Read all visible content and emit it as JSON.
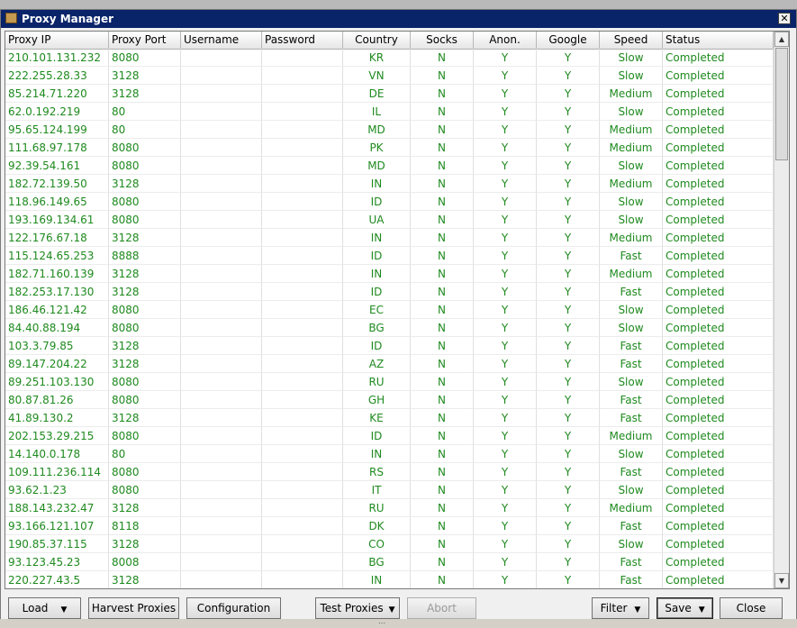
{
  "window": {
    "title": "Proxy Manager",
    "close_glyph": "✕",
    "icon": "box-icon"
  },
  "table": {
    "headers": [
      "Proxy IP",
      "Proxy Port",
      "Username",
      "Password",
      "Country",
      "Socks",
      "Anon.",
      "Google",
      "Speed",
      "Status"
    ],
    "rows": [
      [
        "210.101.131.232",
        "8080",
        "",
        "",
        "KR",
        "N",
        "Y",
        "Y",
        "Slow",
        "Completed"
      ],
      [
        "222.255.28.33",
        "3128",
        "",
        "",
        "VN",
        "N",
        "Y",
        "Y",
        "Slow",
        "Completed"
      ],
      [
        "85.214.71.220",
        "3128",
        "",
        "",
        "DE",
        "N",
        "Y",
        "Y",
        "Medium",
        "Completed"
      ],
      [
        "62.0.192.219",
        "80",
        "",
        "",
        "IL",
        "N",
        "Y",
        "Y",
        "Slow",
        "Completed"
      ],
      [
        "95.65.124.199",
        "80",
        "",
        "",
        "MD",
        "N",
        "Y",
        "Y",
        "Medium",
        "Completed"
      ],
      [
        "111.68.97.178",
        "8080",
        "",
        "",
        "PK",
        "N",
        "Y",
        "Y",
        "Medium",
        "Completed"
      ],
      [
        "92.39.54.161",
        "8080",
        "",
        "",
        "MD",
        "N",
        "Y",
        "Y",
        "Slow",
        "Completed"
      ],
      [
        "182.72.139.50",
        "3128",
        "",
        "",
        "IN",
        "N",
        "Y",
        "Y",
        "Medium",
        "Completed"
      ],
      [
        "118.96.149.65",
        "8080",
        "",
        "",
        "ID",
        "N",
        "Y",
        "Y",
        "Slow",
        "Completed"
      ],
      [
        "193.169.134.61",
        "8080",
        "",
        "",
        "UA",
        "N",
        "Y",
        "Y",
        "Slow",
        "Completed"
      ],
      [
        "122.176.67.18",
        "3128",
        "",
        "",
        "IN",
        "N",
        "Y",
        "Y",
        "Medium",
        "Completed"
      ],
      [
        "115.124.65.253",
        "8888",
        "",
        "",
        "ID",
        "N",
        "Y",
        "Y",
        "Fast",
        "Completed"
      ],
      [
        "182.71.160.139",
        "3128",
        "",
        "",
        "IN",
        "N",
        "Y",
        "Y",
        "Medium",
        "Completed"
      ],
      [
        "182.253.17.130",
        "3128",
        "",
        "",
        "ID",
        "N",
        "Y",
        "Y",
        "Fast",
        "Completed"
      ],
      [
        "186.46.121.42",
        "8080",
        "",
        "",
        "EC",
        "N",
        "Y",
        "Y",
        "Slow",
        "Completed"
      ],
      [
        "84.40.88.194",
        "8080",
        "",
        "",
        "BG",
        "N",
        "Y",
        "Y",
        "Slow",
        "Completed"
      ],
      [
        "103.3.79.85",
        "3128",
        "",
        "",
        "ID",
        "N",
        "Y",
        "Y",
        "Fast",
        "Completed"
      ],
      [
        "89.147.204.22",
        "3128",
        "",
        "",
        "AZ",
        "N",
        "Y",
        "Y",
        "Fast",
        "Completed"
      ],
      [
        "89.251.103.130",
        "8080",
        "",
        "",
        "RU",
        "N",
        "Y",
        "Y",
        "Slow",
        "Completed"
      ],
      [
        "80.87.81.26",
        "8080",
        "",
        "",
        "GH",
        "N",
        "Y",
        "Y",
        "Fast",
        "Completed"
      ],
      [
        "41.89.130.2",
        "3128",
        "",
        "",
        "KE",
        "N",
        "Y",
        "Y",
        "Fast",
        "Completed"
      ],
      [
        "202.153.29.215",
        "8080",
        "",
        "",
        "ID",
        "N",
        "Y",
        "Y",
        "Medium",
        "Completed"
      ],
      [
        "14.140.0.178",
        "80",
        "",
        "",
        "IN",
        "N",
        "Y",
        "Y",
        "Slow",
        "Completed"
      ],
      [
        "109.111.236.114",
        "8080",
        "",
        "",
        "RS",
        "N",
        "Y",
        "Y",
        "Fast",
        "Completed"
      ],
      [
        "93.62.1.23",
        "8080",
        "",
        "",
        "IT",
        "N",
        "Y",
        "Y",
        "Slow",
        "Completed"
      ],
      [
        "188.143.232.47",
        "3128",
        "",
        "",
        "RU",
        "N",
        "Y",
        "Y",
        "Medium",
        "Completed"
      ],
      [
        "93.166.121.107",
        "8118",
        "",
        "",
        "DK",
        "N",
        "Y",
        "Y",
        "Fast",
        "Completed"
      ],
      [
        "190.85.37.115",
        "3128",
        "",
        "",
        "CO",
        "N",
        "Y",
        "Y",
        "Slow",
        "Completed"
      ],
      [
        "93.123.45.23",
        "8008",
        "",
        "",
        "BG",
        "N",
        "Y",
        "Y",
        "Fast",
        "Completed"
      ],
      [
        "220.227.43.5",
        "3128",
        "",
        "",
        "IN",
        "N",
        "Y",
        "Y",
        "Fast",
        "Completed"
      ]
    ],
    "status_color": "#1e8a1e"
  },
  "toolbar": {
    "load_label": "Load",
    "harvest_label": "Harvest Proxies",
    "configuration_label": "Configuration",
    "test_label": "Test Proxies",
    "abort_label": "Abort",
    "filter_label": "Filter",
    "save_label": "Save",
    "close_label": "Close",
    "dropdown_glyph": "▼"
  },
  "scrollbar": {
    "up_glyph": "▲",
    "down_glyph": "▼"
  },
  "statusbar": {
    "grip_glyph": "⋯"
  }
}
